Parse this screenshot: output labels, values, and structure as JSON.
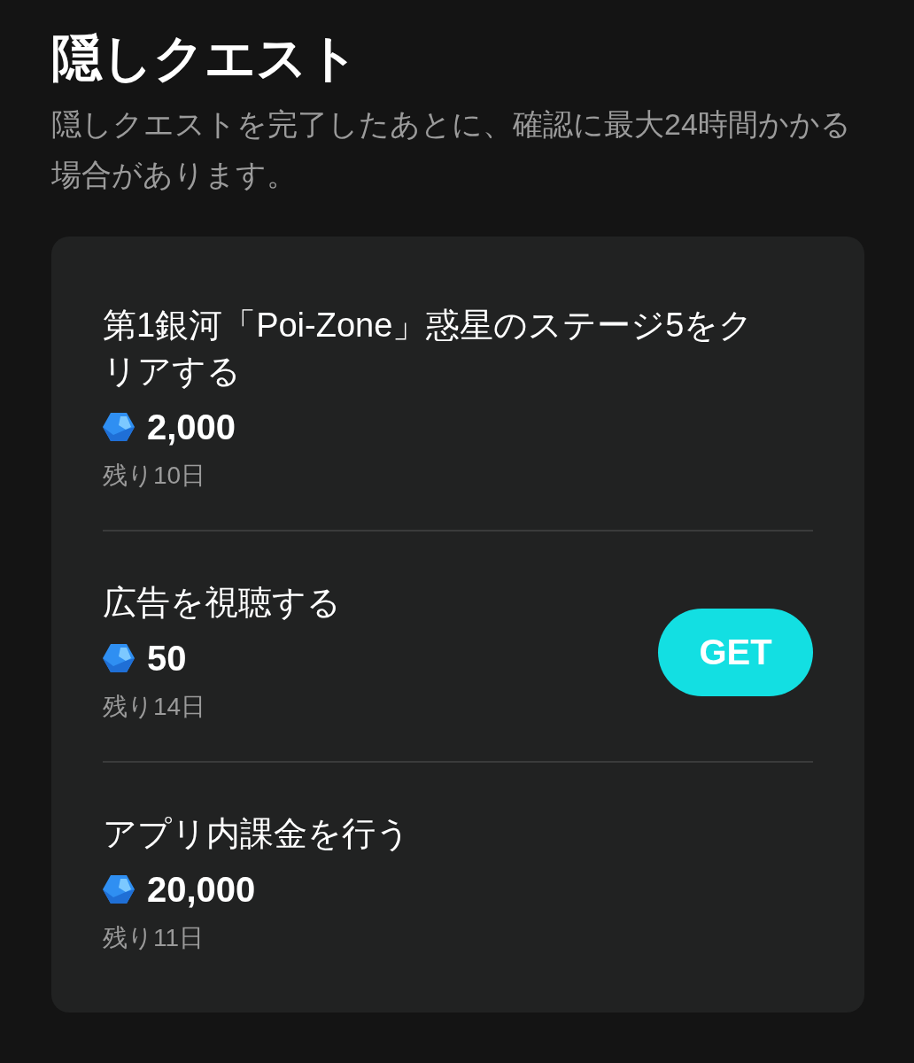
{
  "title": "隠しクエスト",
  "description": "隠しクエストを完了したあとに、確認に最大24時間かかる場合があります。",
  "quests": [
    {
      "title": "第1銀河「Poi-Zone」惑星のステージ5をクリアする",
      "reward": "2,000",
      "remaining": "残り10日"
    },
    {
      "title": "広告を視聴する",
      "reward": "50",
      "remaining": "残り14日",
      "button": {
        "label": "GET"
      }
    },
    {
      "title": "アプリ内課金を行う",
      "reward": "20,000",
      "remaining": "残り11日"
    }
  ]
}
